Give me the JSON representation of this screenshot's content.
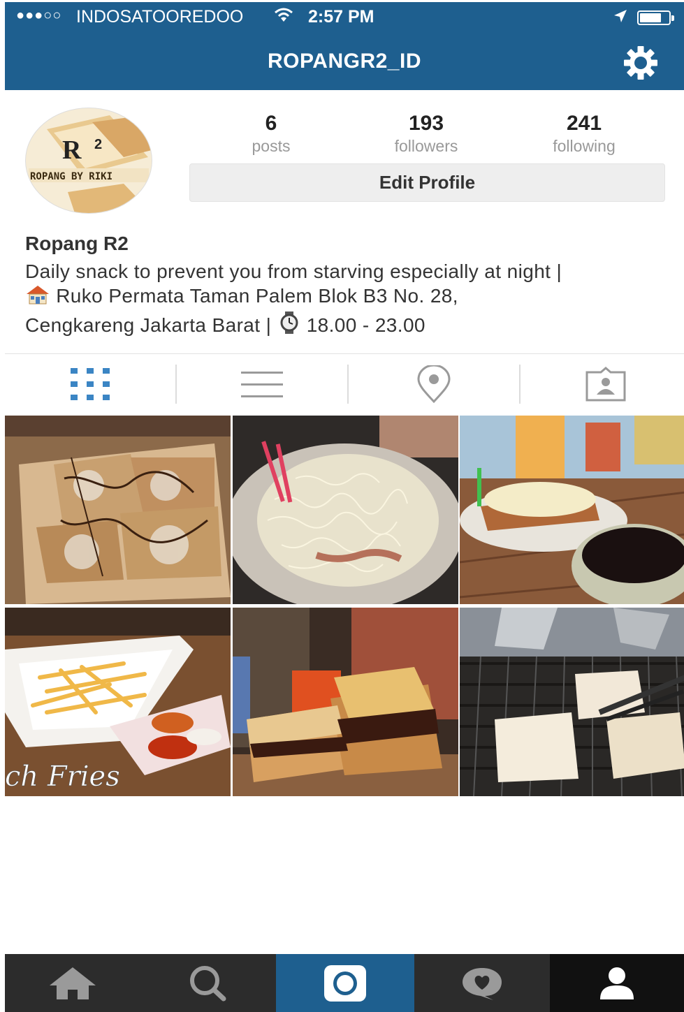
{
  "status_bar": {
    "signal": "●●●○○",
    "carrier": "INDOSATOOREDOO",
    "time": "2:57 PM"
  },
  "header": {
    "username": "ROPANGR2_ID",
    "settings_icon": "gear-icon"
  },
  "profile": {
    "avatar_text": "ROPANG BY RIKI",
    "stats": [
      {
        "value": "6",
        "label": "posts"
      },
      {
        "value": "193",
        "label": "followers"
      },
      {
        "value": "241",
        "label": "following"
      }
    ],
    "edit_button": "Edit Profile"
  },
  "bio": {
    "name": "Ropang R2",
    "line1": "Daily snack to prevent you from starving especially at night |",
    "line2": "Ruko Permata Taman Palem Blok B3 No. 28,",
    "line3a": "Cengkareng Jakarta Barat |",
    "line3b": "18.00 - 23.00"
  },
  "tabs": [
    "grid-view-icon",
    "list-view-icon",
    "location-pin-icon",
    "tagged-photos-icon"
  ],
  "grid": {
    "photo_caption_4": "ch Fries"
  },
  "bottom_nav": [
    "home-icon",
    "search-icon",
    "camera-icon",
    "activity-icon",
    "profile-icon"
  ],
  "colors": {
    "header": "#1e5f8f",
    "accent": "#3b85c4",
    "navbar": "#2c2c2c"
  }
}
